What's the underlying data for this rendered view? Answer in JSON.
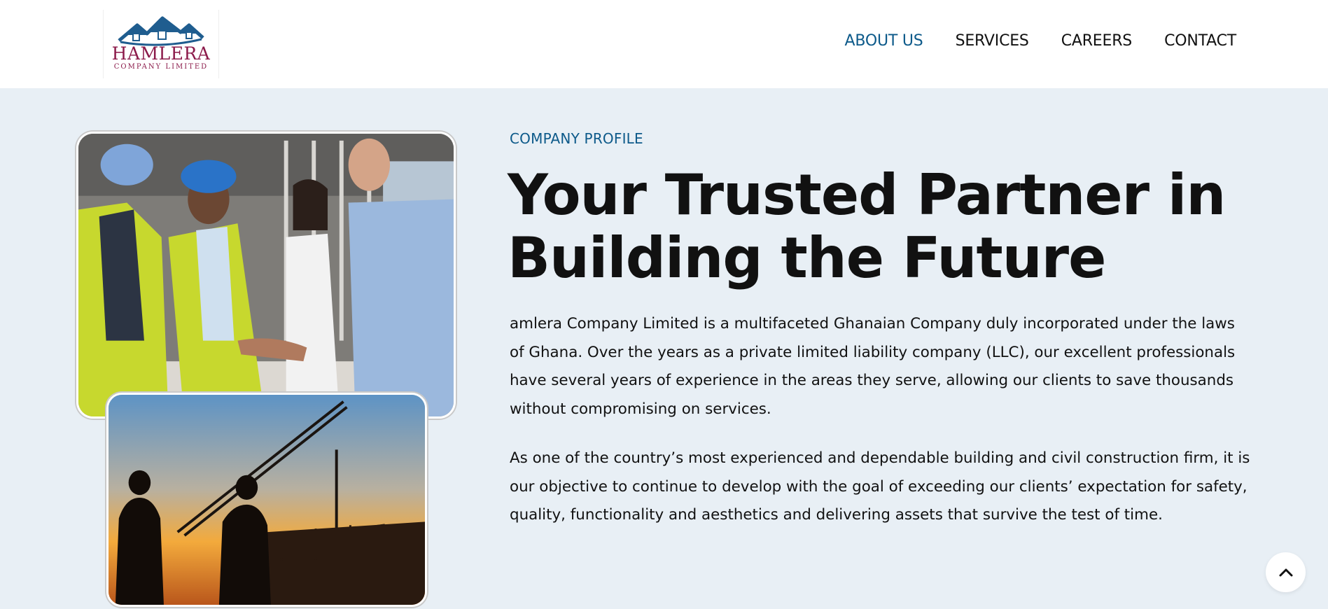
{
  "brand": {
    "name": "HAMLERA",
    "sub": "COMPANY LIMITED"
  },
  "nav": {
    "items": [
      {
        "label": "ABOUT US",
        "active": true
      },
      {
        "label": "SERVICES",
        "active": false
      },
      {
        "label": "CAREERS",
        "active": false
      },
      {
        "label": "CONTACT",
        "active": false
      }
    ]
  },
  "about": {
    "eyebrow": "COMPANY PROFILE",
    "headline_line1": "Your Trusted Partner in",
    "headline_line2": "Building the Future",
    "paragraph1": "amlera Company Limited is a multifaceted Ghanaian Company duly incorporated under the laws of Ghana. Over the years as a private limited liability company (LLC), our excellent professionals have several years of experience in the areas they serve, allowing our clients to save thousands without compromising on services.",
    "paragraph2": "As one of the country’s most experienced and dependable building and civil construction firm, it is our objective to continue to develop with the goal of exceeding our clients’ expectation for safety, quality, functionality and aesthetics and delivering assets that survive the test of time."
  },
  "colors": {
    "accent": "#0d5a8a",
    "brand": "#8b1a4a",
    "background": "#e8eff5"
  },
  "icons": {
    "scroll_top": "chevron-up-icon"
  }
}
